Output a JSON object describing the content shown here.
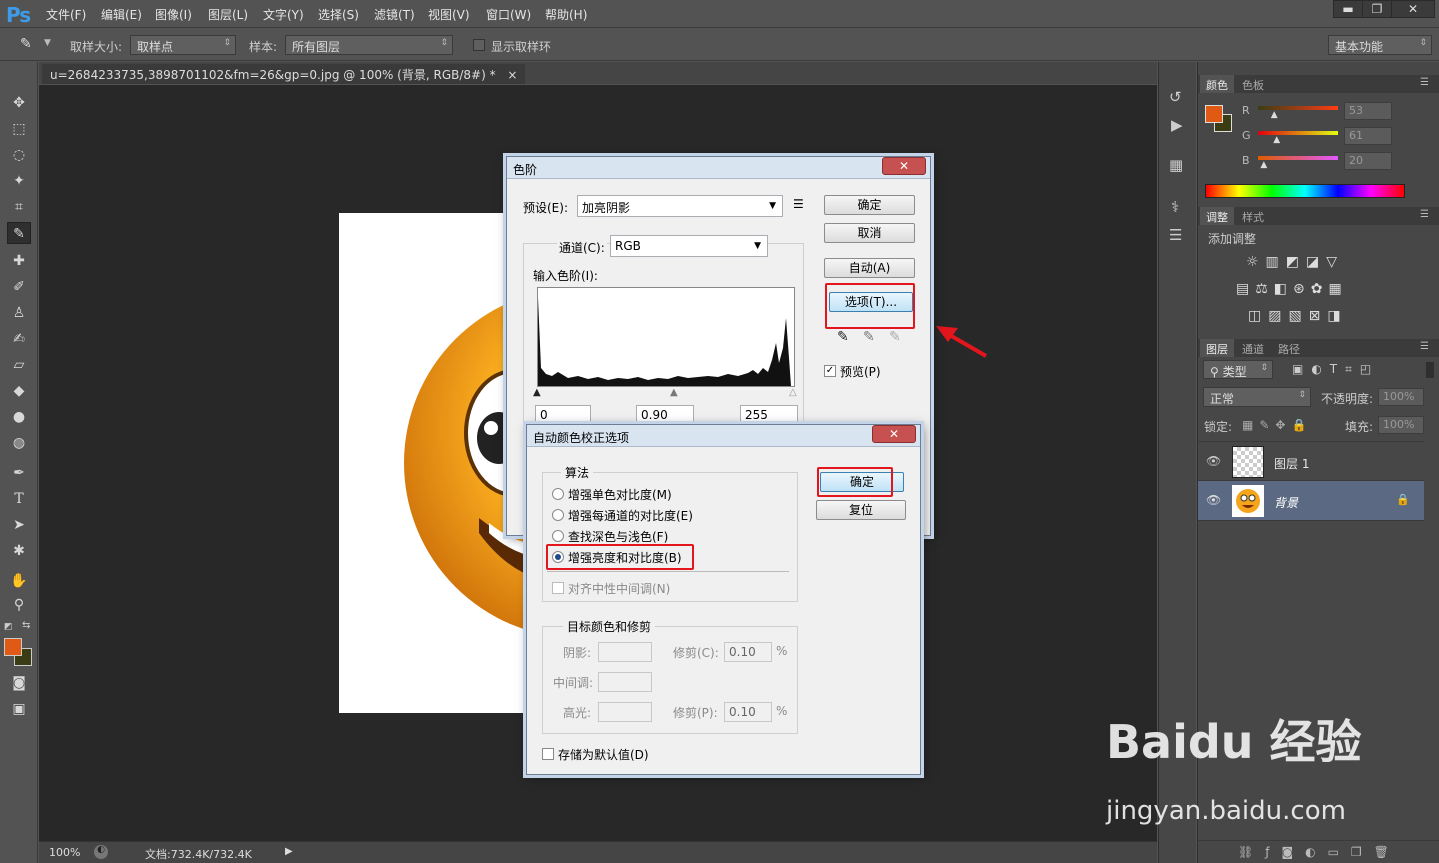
{
  "app": {
    "logo": "Ps"
  },
  "menu": [
    "文件(F)",
    "编辑(E)",
    "图像(I)",
    "图层(L)",
    "文字(Y)",
    "选择(S)",
    "滤镜(T)",
    "视图(V)",
    "窗口(W)",
    "帮助(H)"
  ],
  "window_controls": {
    "minimize": "▬",
    "restore": "❐",
    "close": "✕"
  },
  "options_bar": {
    "sample_size_label": "取样大小:",
    "sample_size_value": "取样点",
    "sample_label": "样本:",
    "sample_value": "所有图层",
    "show_ring_label": "显示取样环",
    "workspace": "基本功能"
  },
  "document": {
    "tab_title": "u=2684233735,3898701102&fm=26&gp=0.jpg @ 100% (背景, RGB/8#) *",
    "tab_close": "×",
    "zoom": "100%",
    "doc_size": "文档:732.4K/732.4K"
  },
  "color_panel": {
    "tabs": [
      "颜色",
      "色板"
    ],
    "channels": [
      {
        "label": "R",
        "value": "53",
        "level": 0.21
      },
      {
        "label": "G",
        "value": "61",
        "level": 0.24
      },
      {
        "label": "B",
        "value": "20",
        "level": 0.08
      }
    ],
    "foreground": "#e05a16",
    "background": "#3a3d14"
  },
  "adjust_panel": {
    "tabs": [
      "调整",
      "样式"
    ],
    "title": "添加调整"
  },
  "layers_panel": {
    "tabs": [
      "图层",
      "通道",
      "路径"
    ],
    "filter_kind": "类型",
    "blend_mode": "正常",
    "opacity_label": "不透明度:",
    "opacity_value": "100%",
    "lock_label": "锁定:",
    "fill_label": "填充:",
    "fill_value": "100%",
    "layers": [
      {
        "name": "图层 1"
      },
      {
        "name": "背景"
      }
    ]
  },
  "levels_dialog": {
    "title": "色阶",
    "close": "✕",
    "preset_label": "预设(E):",
    "preset_value": "加亮阴影",
    "channel_label": "通道(C):",
    "channel_value": "RGB",
    "input_levels_label": "输入色阶(I):",
    "input_values": [
      "0",
      "0.90",
      "255"
    ],
    "buttons": {
      "ok": "确定",
      "cancel": "取消",
      "auto": "自动(A)",
      "options": "选项(T)..."
    },
    "preview_label": "预览(P)",
    "preview_checked": true
  },
  "auto_color_dialog": {
    "title": "自动颜色校正选项",
    "close": "✕",
    "algorithm_legend": "算法",
    "algorithms": [
      {
        "label": "增强单色对比度(M)",
        "selected": false
      },
      {
        "label": "增强每通道的对比度(E)",
        "selected": false
      },
      {
        "label": "查找深色与浅色(F)",
        "selected": false
      },
      {
        "label": "增强亮度和对比度(B)",
        "selected": true
      }
    ],
    "snap_neutral_label": "对齐中性中间调(N)",
    "target_legend": "目标颜色和修剪",
    "shadows_label": "阴影:",
    "midtones_label": "中间调:",
    "highlights_label": "高光:",
    "clip_shadows_label": "修剪(C):",
    "clip_shadows_value": "0.10",
    "clip_highlights_label": "修剪(P):",
    "clip_highlights_value": "0.10",
    "percent": "%",
    "save_default_label": "存储为默认值(D)",
    "buttons": {
      "ok": "确定",
      "reset": "复位"
    }
  },
  "watermark": {
    "brand": "Baidu 经验",
    "url": "jingyan.baidu.com"
  }
}
